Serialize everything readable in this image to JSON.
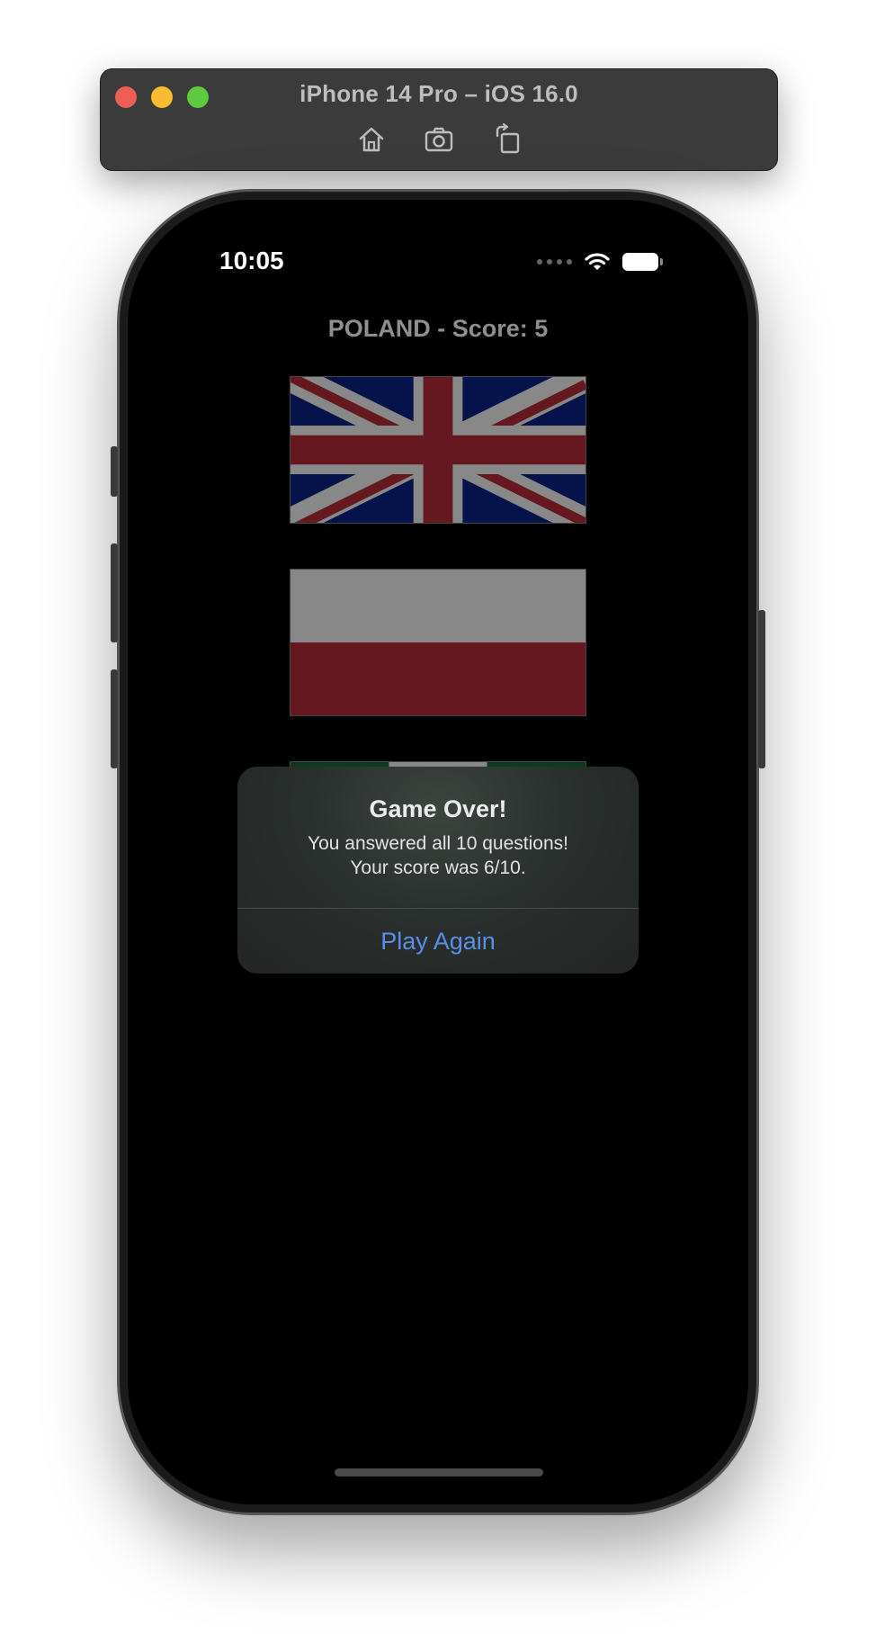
{
  "simulator": {
    "title": "iPhone 14 Pro – iOS 16.0",
    "tools": [
      "home-icon",
      "screenshot-icon",
      "rotate-icon"
    ]
  },
  "status_bar": {
    "time": "10:05",
    "icons": [
      "cellular-dots-icon",
      "wifi-icon",
      "battery-icon"
    ]
  },
  "game": {
    "question": "POLAND - Score: 5",
    "flags": [
      {
        "country_flag": "uk-flag"
      },
      {
        "country_flag": "poland-flag"
      },
      {
        "country_flag": "partially-hidden-flag"
      }
    ]
  },
  "alert": {
    "title": "Game Over!",
    "message_line1": "You answered all 10 questions!",
    "message_line2": "Your score was 6/10.",
    "button": "Play Again"
  },
  "colors": {
    "alert_button": "#5a8fe8",
    "uk_blue": "#06124a",
    "uk_red": "#661820",
    "dim_white": "#888888"
  }
}
